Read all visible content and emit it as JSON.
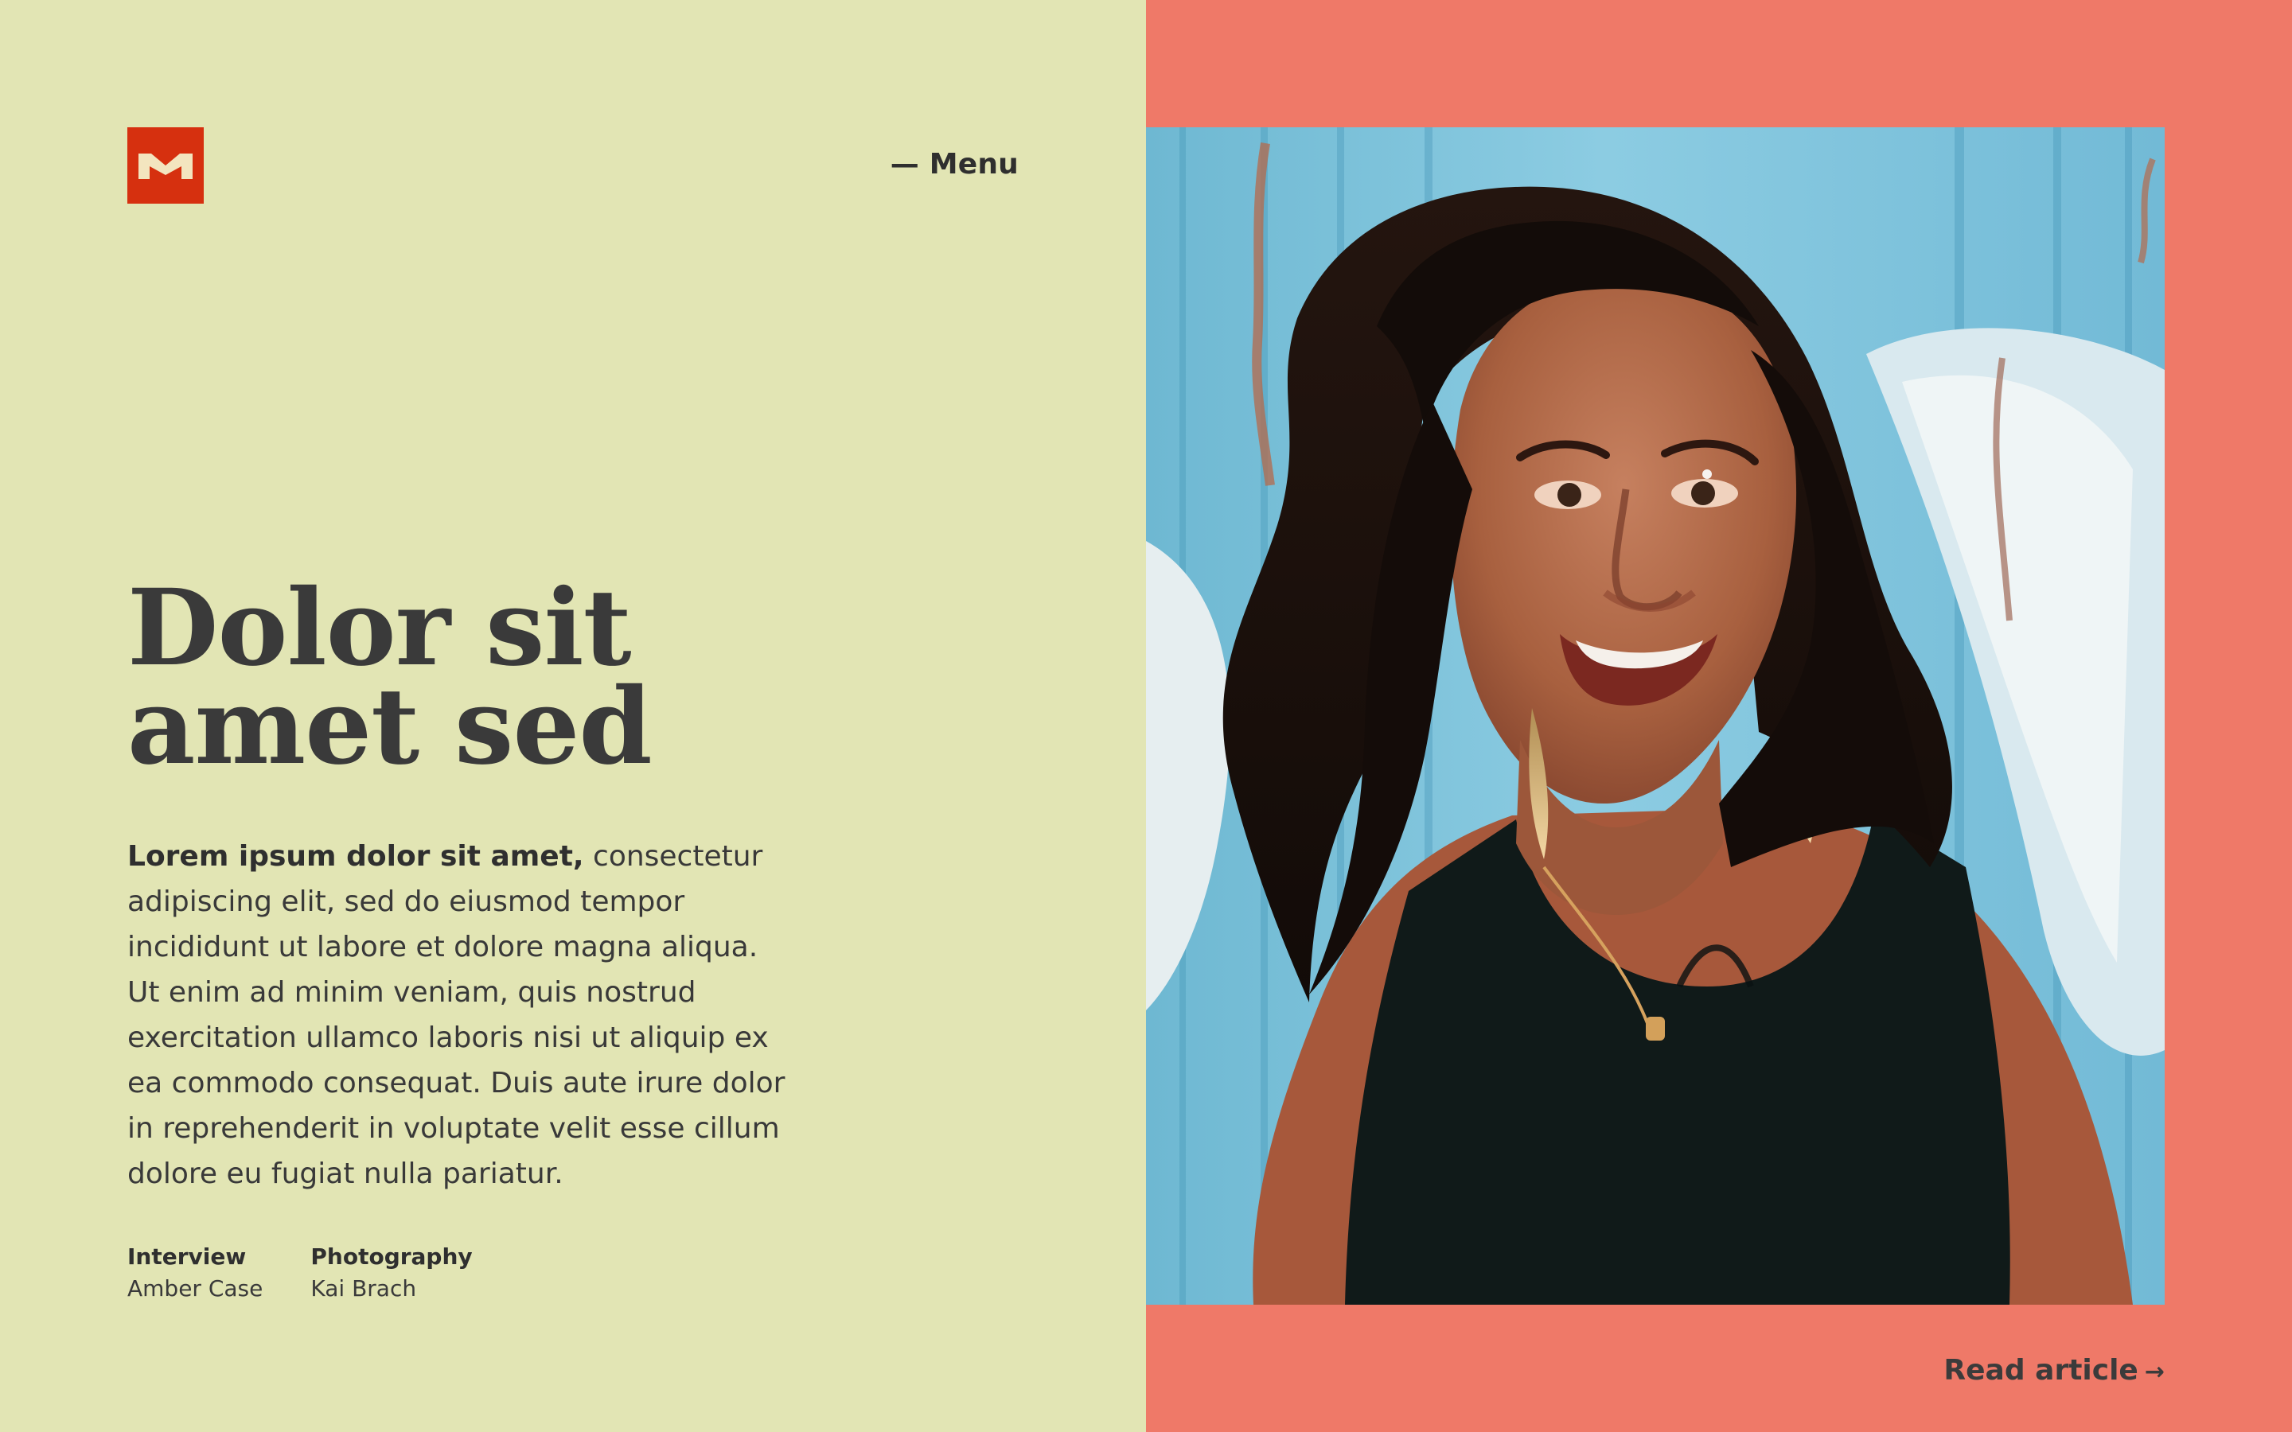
{
  "header": {
    "logo": {
      "icon": "m-logo-icon"
    },
    "menu_label": "— Menu"
  },
  "hero": {
    "title_line1": "Dolor sit",
    "title_line2": "amet sed",
    "intro_bold": "Lorem ipsum dolor sit amet,",
    "intro_body": " consectetur adipiscing elit, sed do eiusmod tempor incididunt ut labore et dolore magna aliqua. Ut enim ad minim veniam, quis nostrud exercitation ullamco laboris nisi ut aliquip ex ea commodo consequat. Duis aute irure dolor in reprehenderit in voluptate velit esse cillum dolore eu fugiat nulla pariatur."
  },
  "credits": [
    {
      "role": "Interview",
      "name": "Amber Case"
    },
    {
      "role": "Photography",
      "name": "Kai Brach"
    }
  ],
  "cta": {
    "label": "Read article",
    "arrow": "→"
  },
  "colors": {
    "left_background": "#e2e5b4",
    "right_background": "#ef7968",
    "logo_background": "#d6300f",
    "text": "#3c3c3c"
  }
}
